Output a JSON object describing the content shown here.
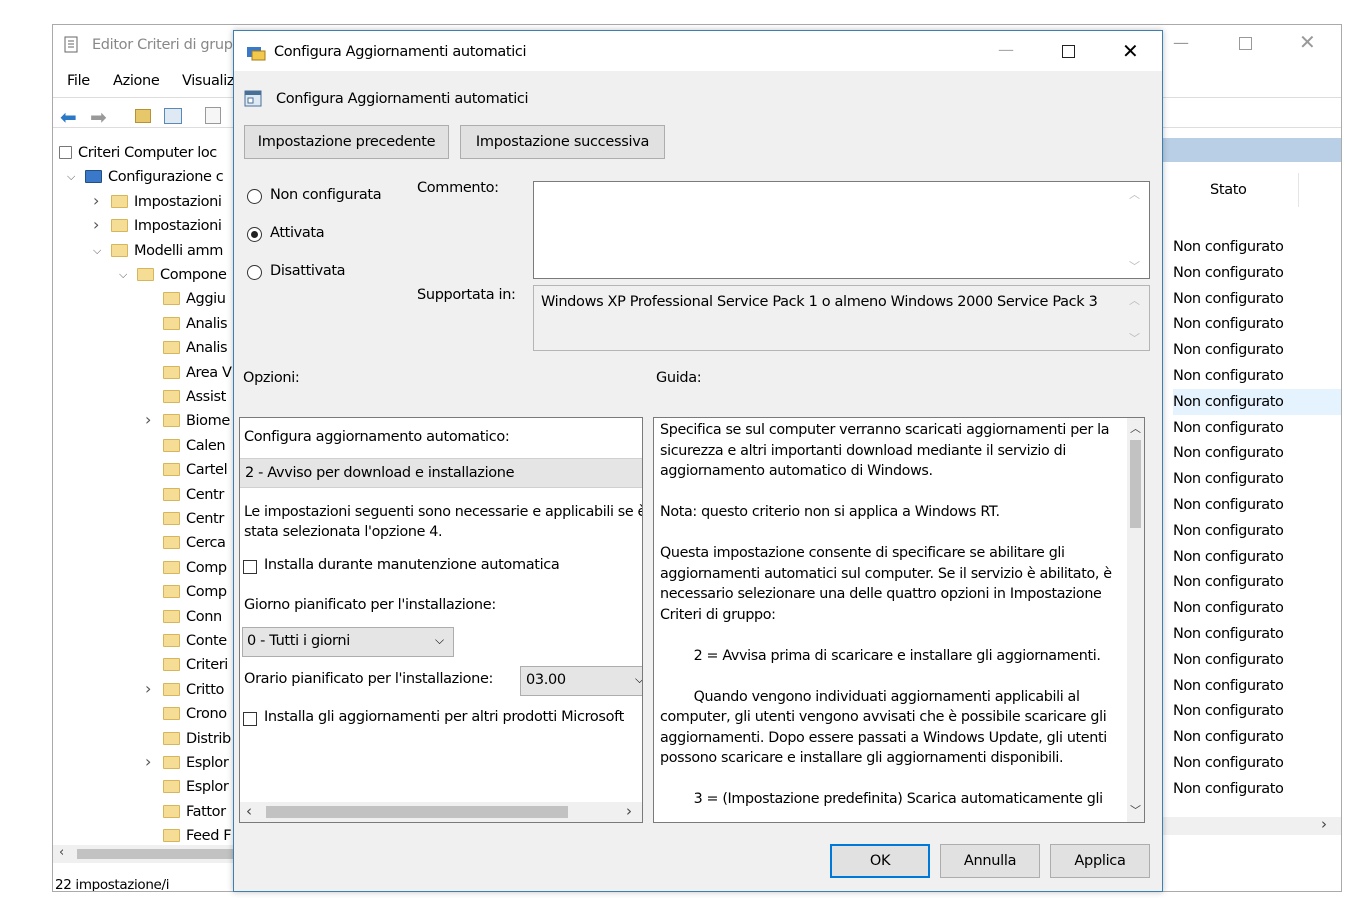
{
  "background_window": {
    "title": "Editor Criteri di grup",
    "menu": [
      "File",
      "Azione",
      "Visualiz"
    ],
    "tree": [
      {
        "label": "Criteri Computer loc",
        "indent": 0,
        "icon": "doc",
        "chev": ""
      },
      {
        "label": "Configurazione c",
        "indent": 1,
        "icon": "computer",
        "chev": "v"
      },
      {
        "label": "Impostazioni",
        "indent": 2,
        "icon": "folder",
        "chev": ">"
      },
      {
        "label": "Impostazioni",
        "indent": 2,
        "icon": "folder",
        "chev": ">"
      },
      {
        "label": "Modelli amm",
        "indent": 2,
        "icon": "folder",
        "chev": "v"
      },
      {
        "label": "Compone",
        "indent": 3,
        "icon": "folder",
        "chev": "v"
      },
      {
        "label": "Aggiu",
        "indent": 4,
        "icon": "folder",
        "chev": ""
      },
      {
        "label": "Analis",
        "indent": 4,
        "icon": "folder",
        "chev": ""
      },
      {
        "label": "Analis",
        "indent": 4,
        "icon": "folder",
        "chev": ""
      },
      {
        "label": "Area V",
        "indent": 4,
        "icon": "folder",
        "chev": ""
      },
      {
        "label": "Assist",
        "indent": 4,
        "icon": "folder",
        "chev": ""
      },
      {
        "label": "Biome",
        "indent": 4,
        "icon": "folder",
        "chev": ">"
      },
      {
        "label": "Calen",
        "indent": 4,
        "icon": "folder",
        "chev": ""
      },
      {
        "label": "Cartel",
        "indent": 4,
        "icon": "folder",
        "chev": ""
      },
      {
        "label": "Centr",
        "indent": 4,
        "icon": "folder",
        "chev": ""
      },
      {
        "label": "Centr",
        "indent": 4,
        "icon": "folder",
        "chev": ""
      },
      {
        "label": "Cerca",
        "indent": 4,
        "icon": "folder",
        "chev": ""
      },
      {
        "label": "Comp",
        "indent": 4,
        "icon": "folder",
        "chev": ""
      },
      {
        "label": "Comp",
        "indent": 4,
        "icon": "folder",
        "chev": ""
      },
      {
        "label": "Conn",
        "indent": 4,
        "icon": "folder",
        "chev": ""
      },
      {
        "label": "Conte",
        "indent": 4,
        "icon": "folder",
        "chev": ""
      },
      {
        "label": "Criteri",
        "indent": 4,
        "icon": "folder",
        "chev": ""
      },
      {
        "label": "Critto",
        "indent": 4,
        "icon": "folder",
        "chev": ">"
      },
      {
        "label": "Crono",
        "indent": 4,
        "icon": "folder",
        "chev": ""
      },
      {
        "label": "Distrib",
        "indent": 4,
        "icon": "folder",
        "chev": ""
      },
      {
        "label": "Esplor",
        "indent": 4,
        "icon": "folder",
        "chev": ">"
      },
      {
        "label": "Esplor",
        "indent": 4,
        "icon": "folder",
        "chev": ""
      },
      {
        "label": "Fattor",
        "indent": 4,
        "icon": "folder",
        "chev": ""
      },
      {
        "label": "Feed F",
        "indent": 4,
        "icon": "folder",
        "chev": ""
      }
    ],
    "stato_header": "Stato",
    "stato_value": "Non configurato",
    "stato_count": 22,
    "status_bar": "22 impostazione/i"
  },
  "dialog": {
    "title": "Configura Aggiornamenti automatici",
    "policy_name": "Configura Aggiornamenti automatici",
    "prev_button": "Impostazione precedente",
    "next_button": "Impostazione successiva",
    "radio_not_configured": "Non configurata",
    "radio_enabled": "Attivata",
    "radio_disabled": "Disattivata",
    "selected_radio": "Attivata",
    "comment_label": "Commento:",
    "supported_label": "Supportata in:",
    "supported_value": "Windows XP Professional Service Pack 1 o almeno Windows 2000 Service Pack 3",
    "options_label": "Opzioni:",
    "help_label": "Guida:",
    "options": {
      "configure_label": "Configura aggiornamento automatico:",
      "configure_value": "2 - Avviso per download e installazione",
      "note": "Le impostazioni seguenti sono necessarie e applicabili se è stata selezionata l'opzione 4.",
      "maintenance_checkbox": "Installa durante manutenzione automatica",
      "day_label": "Giorno pianificato per l'installazione:",
      "day_value": "0 - Tutti i giorni",
      "time_label": "Orario pianificato per l'installazione:",
      "time_value": "03.00",
      "other_products_checkbox": "Installa gli aggiornamenti per altri prodotti Microsoft"
    },
    "help_text": "Specifica se sul computer verranno scaricati aggiornamenti per la sicurezza e altri importanti download mediante il servizio di aggiornamento automatico di Windows.\n\nNota: questo criterio non si applica a Windows RT.\n\nQuesta impostazione consente di specificare se abilitare gli aggiornamenti automatici sul computer. Se il servizio è abilitato, è necessario selezionare una delle quattro opzioni in Impostazione Criteri di gruppo:\n\n        2 = Avvisa prima di scaricare e installare gli aggiornamenti.\n\n        Quando vengono individuati aggiornamenti applicabili al computer, gli utenti vengono avvisati che è possibile scaricare gli aggiornamenti. Dopo essere passati a Windows Update, gli utenti possono scaricare e installare gli aggiornamenti disponibili.\n\n        3 = (Impostazione predefinita) Scarica automaticamente gli",
    "ok_button": "OK",
    "cancel_button": "Annulla",
    "apply_button": "Applica"
  },
  "colors": {
    "accent": "#0078d7",
    "selection": "#e5f3ff",
    "header_band": "#b9cfe6"
  }
}
